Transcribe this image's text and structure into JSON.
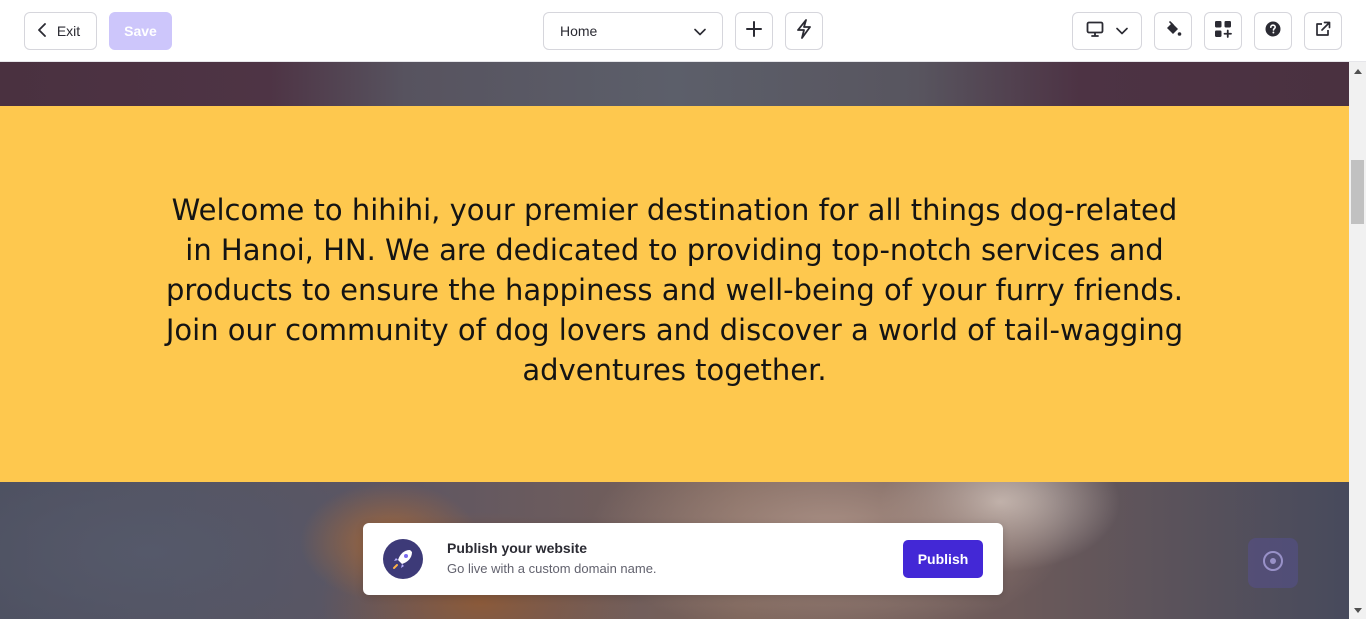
{
  "toolbar": {
    "exit_label": "Exit",
    "save_label": "Save",
    "page_select_value": "Home",
    "icons": {
      "exit": "chevron-left-icon",
      "page_select": "chevron-down-icon",
      "add": "plus-icon",
      "quick": "lightning-bolt-icon",
      "device": "desktop-monitor-icon",
      "theme": "paint-bucket-icon",
      "apps": "add-widgets-icon",
      "help": "question-circle-icon",
      "open": "external-link-icon"
    }
  },
  "welcome": {
    "text": "Welcome to hihihi, your premier destination for all things dog-related in Hanoi, HN. We are dedicated to providing top-notch services and products to ensure the happiness and well-being of your furry friends. Join our community of dog lovers and discover a world of tail-wagging adventures together.",
    "background_color": "#fec84e"
  },
  "publish_card": {
    "title": "Publish your website",
    "subtitle": "Go live with a custom domain name.",
    "button_label": "Publish",
    "icon": "rocket-icon",
    "accent_color": "#4328d6"
  },
  "chat_widget": {
    "icon": "chat-assistant-icon"
  }
}
